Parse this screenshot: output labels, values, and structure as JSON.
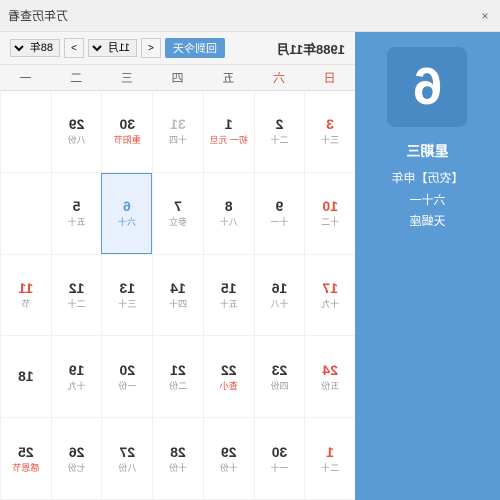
{
  "window": {
    "title": "万年历查看",
    "close_label": "×"
  },
  "left_panel": {
    "big_day": "6",
    "weekday": "星期三",
    "solar_info": "【农历】申年",
    "lunar_date": "六十一",
    "extra": "天蝎座"
  },
  "header": {
    "month_year_left": "1988年11月",
    "today_btn": "回到今天",
    "nav_prev": "<",
    "nav_next": ">",
    "month_select": "11月",
    "year_select": "88年"
  },
  "day_headers": [
    "日",
    "六",
    "五",
    "四",
    "三",
    "二",
    "一"
  ],
  "weeks": [
    [
      {
        "num": "3",
        "lunar": "三十",
        "red": true
      },
      {
        "num": "2",
        "lunar": "二十",
        "red": false
      },
      {
        "num": "1",
        "lunar": "初一 元旦",
        "red": false,
        "event": true
      },
      {
        "num": "31",
        "lunar": "十四",
        "red": false,
        "gray": true
      },
      {
        "num": "30",
        "lunar": "重阳节",
        "red": false,
        "event": true
      },
      {
        "num": "29",
        "lunar": "八份",
        "red": false
      },
      {
        "num": "",
        "lunar": "",
        "red": false,
        "gray": true
      }
    ],
    [
      {
        "num": "10",
        "lunar": "十二",
        "red": true
      },
      {
        "num": "9",
        "lunar": "十一",
        "red": false
      },
      {
        "num": "8",
        "lunar": "八十",
        "red": false
      },
      {
        "num": "7",
        "lunar": "参立",
        "red": false
      },
      {
        "num": "6",
        "lunar": "六十",
        "red": false,
        "today": true
      },
      {
        "num": "5",
        "lunar": "五十",
        "red": false
      },
      {
        "num": "",
        "lunar": "",
        "red": false,
        "gray": true
      }
    ],
    [
      {
        "num": "17",
        "lunar": "十九",
        "red": true
      },
      {
        "num": "16",
        "lunar": "十八",
        "red": false
      },
      {
        "num": "15",
        "lunar": "五十",
        "red": false
      },
      {
        "num": "14",
        "lunar": "四十",
        "red": false
      },
      {
        "num": "13",
        "lunar": "三十",
        "red": false
      },
      {
        "num": "12",
        "lunar": "二十",
        "red": false
      },
      {
        "num": "11",
        "lunar": "节",
        "red": true
      }
    ],
    [
      {
        "num": "24",
        "lunar": "五份",
        "red": true
      },
      {
        "num": "23",
        "lunar": "四份",
        "red": false
      },
      {
        "num": "22",
        "lunar": "查小",
        "red": false,
        "event": true
      },
      {
        "num": "21",
        "lunar": "二份",
        "red": false
      },
      {
        "num": "20",
        "lunar": "一份",
        "red": false
      },
      {
        "num": "19",
        "lunar": "十九",
        "red": false
      },
      {
        "num": "18",
        "lunar": "",
        "red": false
      }
    ],
    [
      {
        "num": "1",
        "lunar": "二十",
        "red": true
      },
      {
        "num": "30",
        "lunar": "一十",
        "red": false
      },
      {
        "num": "29",
        "lunar": "十份",
        "red": false
      },
      {
        "num": "28",
        "lunar": "十份",
        "red": false
      },
      {
        "num": "27",
        "lunar": "八份",
        "red": false
      },
      {
        "num": "26",
        "lunar": "七份",
        "red": false
      },
      {
        "num": "25",
        "lunar": "感恩节",
        "red": false,
        "event": true
      }
    ]
  ],
  "colors": {
    "accent": "#5b9bd5",
    "red": "#e74c3c",
    "gray": "#bbb",
    "today_bg": "#e8f0fe"
  }
}
